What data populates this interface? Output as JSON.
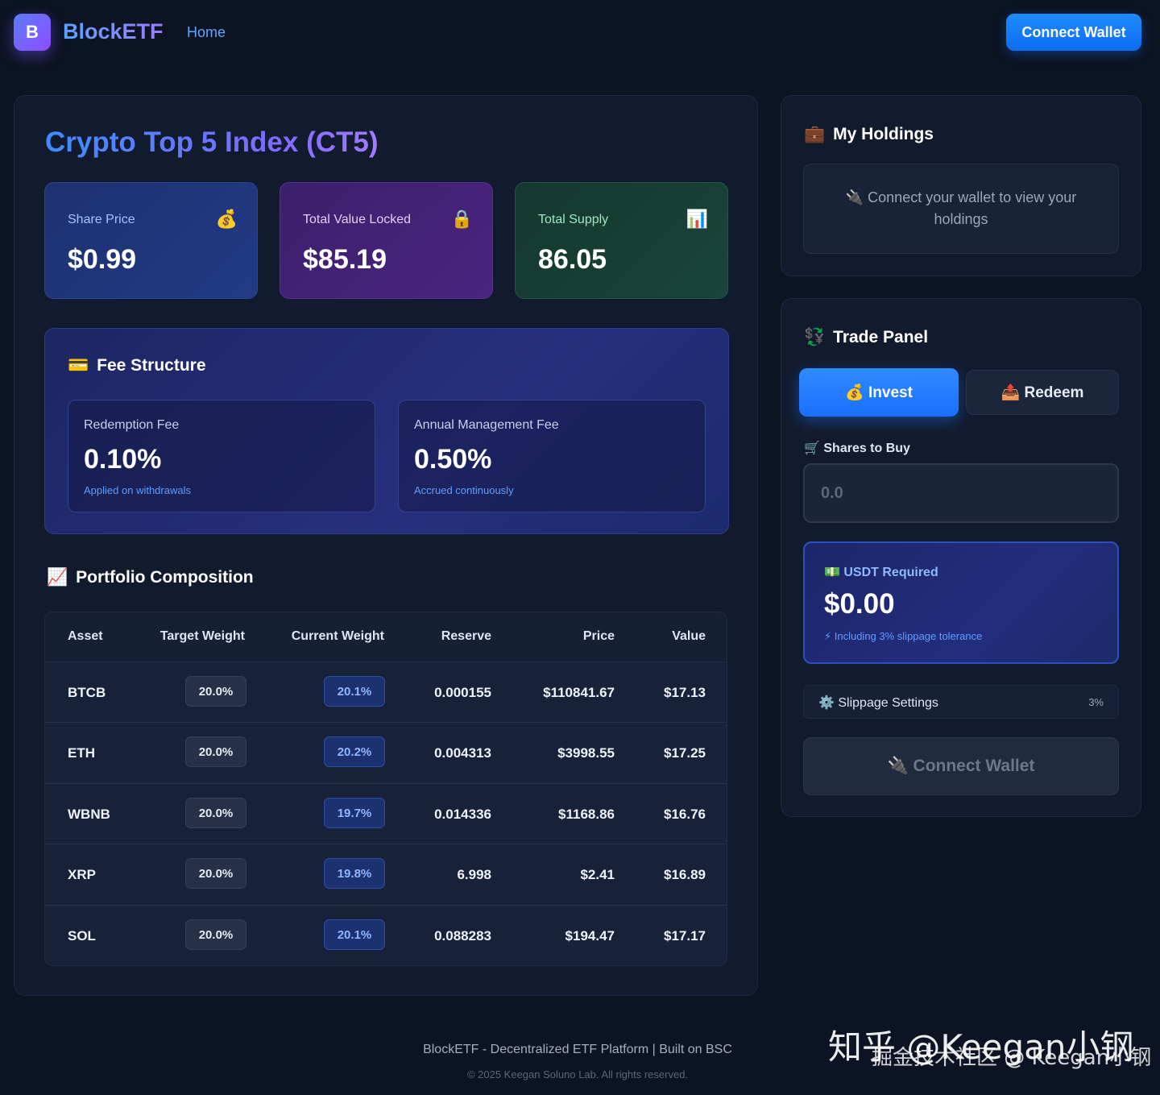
{
  "header": {
    "logo_letter": "B",
    "brand": "BlockETF",
    "nav_home": "Home",
    "connect_wallet": "Connect Wallet"
  },
  "main": {
    "title": "Crypto Top 5 Index (CT5)",
    "stats": [
      {
        "label": "Share Price",
        "value": "$0.99",
        "icon": "money-bag-icon",
        "glyph": "💰"
      },
      {
        "label": "Total Value Locked",
        "value": "$85.19",
        "icon": "lock-icon",
        "glyph": "🔒"
      },
      {
        "label": "Total Supply",
        "value": "86.05",
        "icon": "bar-chart-icon",
        "glyph": "📊"
      }
    ],
    "fees": {
      "title": "Fee Structure",
      "icon_glyph": "💳",
      "items": [
        {
          "label": "Redemption Fee",
          "value": "0.10%",
          "note": "Applied on withdrawals"
        },
        {
          "label": "Annual Management Fee",
          "value": "0.50%",
          "note": "Accrued continuously"
        }
      ]
    },
    "portfolio": {
      "title": "Portfolio Composition",
      "icon_glyph": "📈",
      "columns": [
        "Asset",
        "Target Weight",
        "Current Weight",
        "Reserve",
        "Price",
        "Value"
      ],
      "rows": [
        {
          "asset": "BTCB",
          "target": "20.0%",
          "current": "20.1%",
          "reserve": "0.000155",
          "price": "$110841.67",
          "value": "$17.13"
        },
        {
          "asset": "ETH",
          "target": "20.0%",
          "current": "20.2%",
          "reserve": "0.004313",
          "price": "$3998.55",
          "value": "$17.25"
        },
        {
          "asset": "WBNB",
          "target": "20.0%",
          "current": "19.7%",
          "reserve": "0.014336",
          "price": "$1168.86",
          "value": "$16.76"
        },
        {
          "asset": "XRP",
          "target": "20.0%",
          "current": "19.8%",
          "reserve": "6.998",
          "price": "$2.41",
          "value": "$16.89"
        },
        {
          "asset": "SOL",
          "target": "20.0%",
          "current": "20.1%",
          "reserve": "0.088283",
          "price": "$194.47",
          "value": "$17.17"
        }
      ]
    }
  },
  "holdings": {
    "title": "My Holdings",
    "icon_glyph": "💼",
    "empty_glyph": "🔌",
    "empty_text": "Connect your wallet to view your holdings"
  },
  "trade": {
    "title": "Trade Panel",
    "icon_glyph": "💱",
    "tab_invest": "💰 Invest",
    "tab_redeem": "📤 Redeem",
    "shares_label": "🛒 Shares to Buy",
    "shares_placeholder": "0.0",
    "usdt_label": "💵 USDT Required",
    "usdt_value": "$0.00",
    "usdt_note": "⚡ Including 3% slippage tolerance",
    "slippage_label": "⚙️ Slippage Settings",
    "slippage_value": "3%",
    "connect_wallet": "🔌 Connect Wallet"
  },
  "footer": {
    "main": "BlockETF - Decentralized ETF Platform | Built on BSC",
    "copy": "© 2025 Keegan Soluno Lab. All rights reserved."
  },
  "watermark": {
    "line1": "知乎 @Keegan小钢",
    "line2": "掘金技术社区 @ Keegan小钢"
  },
  "colors": {
    "background": "#0c1322",
    "accent": "#1f8bff",
    "share_card": "#223a86",
    "tvl_card": "#4a2480",
    "supply_card": "#1a4438"
  }
}
